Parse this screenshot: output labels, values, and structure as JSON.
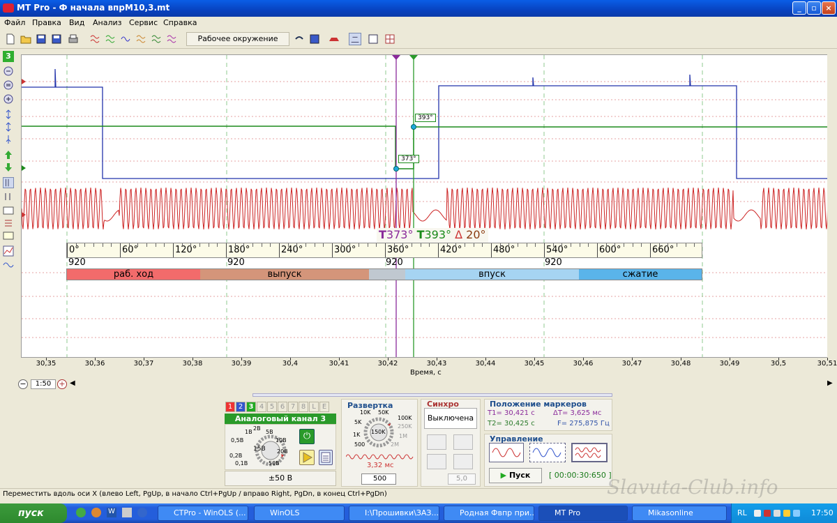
{
  "window": {
    "title": "MT Pro - Ф  начала впрМ10,3.mt"
  },
  "menu": [
    "Файл",
    "Правка",
    "Вид",
    "Анализ",
    "Сервис",
    "Справка"
  ],
  "toolbar": {
    "environment_label": "Рабочее окружение"
  },
  "left_toolbar": {
    "channel_badge": "3"
  },
  "plot": {
    "x_ticks": [
      "30,35",
      "30,36",
      "30,37",
      "30,38",
      "30,39",
      "30,4",
      "30,41",
      "30,42",
      "30,43",
      "30,44",
      "30,45",
      "30,46",
      "30,47",
      "30,48",
      "30,49",
      "30,5",
      "30,51"
    ],
    "x_label": "Время, с",
    "marker1_label": "373°",
    "marker2_label": "393°",
    "marker_readout": {
      "t1": "373",
      "t2": "393",
      "delta": "20°"
    },
    "angle_scale": [
      "0°",
      "60°",
      "120°",
      "180°",
      "240°",
      "300°",
      "360°",
      "420°",
      "480°",
      "540°",
      "600°",
      "660°"
    ],
    "rpm_labels": [
      "920",
      "920",
      "920",
      "920"
    ],
    "phases": [
      {
        "label": "раб. ход",
        "color": "#f26b6b"
      },
      {
        "label": "выпуск",
        "color": "#d4957a"
      },
      {
        "label": "",
        "color": "#c0c8d0"
      },
      {
        "label": "впуск",
        "color": "#a6d4f2"
      },
      {
        "label": "сжатие",
        "color": "#5ab4ea"
      }
    ],
    "colors": {
      "blue_trace": "#2233aa",
      "green_trace": "#1a8a1a",
      "red_trace": "#cc2222",
      "marker1": "#8a2a9a",
      "marker2": "#2a9a2a"
    }
  },
  "scrollbar": {
    "zoom_label": "1:50"
  },
  "channels_panel": {
    "tabs": [
      "1",
      "2",
      "3",
      "4",
      "5",
      "6",
      "7",
      "8",
      "L",
      "E"
    ],
    "title": "Аналоговый канал 3",
    "knob_labels": [
      "1В",
      "2В",
      "5В",
      "0,5В",
      "10В",
      "15В",
      "0,2В",
      "20В",
      "0,1В",
      "50В"
    ],
    "range_label": "±50 В"
  },
  "sweep_panel": {
    "title": "Развертка",
    "knob_labels": [
      "10K",
      "50K",
      "5K",
      "100K",
      "150K",
      "250K",
      "1K",
      "1M",
      "500",
      "2M"
    ],
    "period": "3,32 мс",
    "spin_value": "500"
  },
  "sync_panel": {
    "title": "Синхро",
    "mode": "Выключена",
    "level": "5,0"
  },
  "markers_panel": {
    "title": "Положение маркеров",
    "t1": "T1= 30,421 с",
    "dt": "ΔT= 3,625 мс",
    "t2": "T2= 30,425 с",
    "f": "F= 275,875 Гц"
  },
  "control_panel": {
    "title": "Управление",
    "start_label": "Пуск",
    "timer": "[ 00:00:30:650 ]"
  },
  "status": {
    "text": "Переместить вдоль оси X (влево Left, PgUp, в начало Ctrl+PgUp / вправо Right, PgDn, в конец Ctrl+PgDn)"
  },
  "watermark": "Slavuta-Club.info",
  "taskbar": {
    "start": "пуск",
    "tasks": [
      "CTPro - WinOLS (...",
      "WinOLS",
      "I:\\Прошивки\\ЗАЗ...",
      "Родная Фвпр при...",
      "MT Pro",
      "Mikasonline"
    ],
    "lang": "RL",
    "clock": "17:50"
  }
}
